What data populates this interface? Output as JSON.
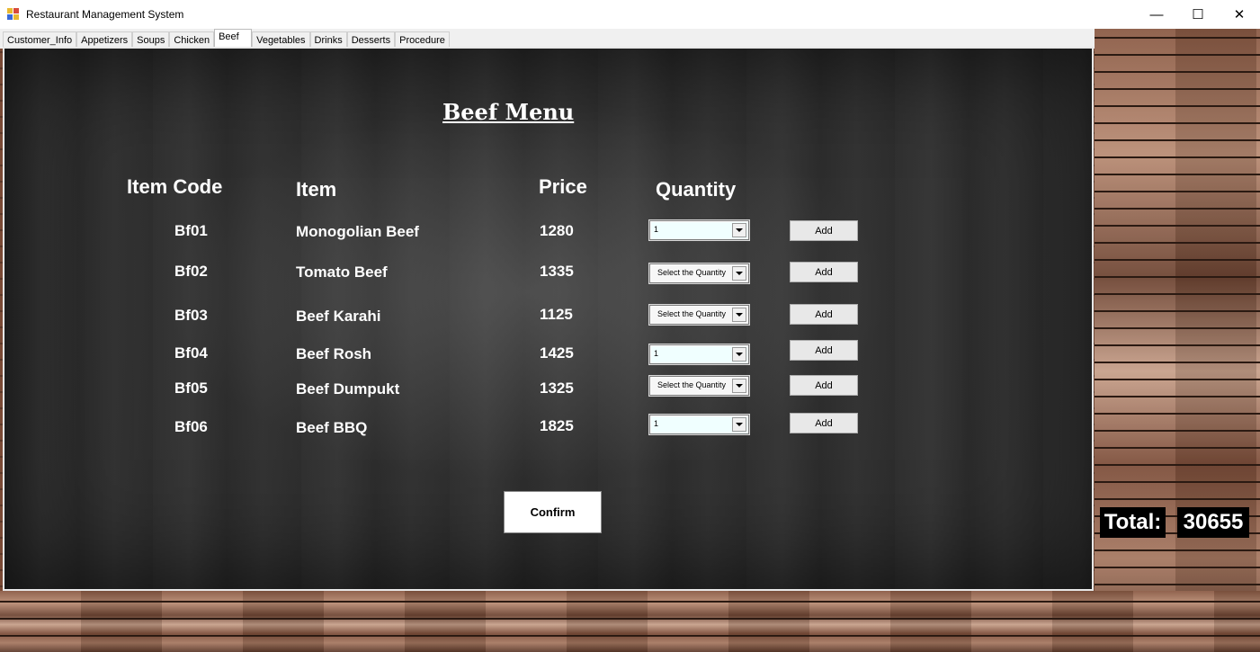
{
  "window": {
    "title": "Restaurant Management System",
    "controls": {
      "minimize": "—",
      "maximize": "☐",
      "close": "✕"
    }
  },
  "tabs": [
    {
      "label": "Customer_Info",
      "active": false
    },
    {
      "label": "Appetizers",
      "active": false
    },
    {
      "label": "Soups",
      "active": false
    },
    {
      "label": "Chicken",
      "active": false
    },
    {
      "label": "Beef",
      "active": true
    },
    {
      "label": "Vegetables",
      "active": false
    },
    {
      "label": "Drinks",
      "active": false
    },
    {
      "label": "Desserts",
      "active": false
    },
    {
      "label": "Procedure",
      "active": false
    }
  ],
  "menu": {
    "heading": "Beef Menu",
    "columns": {
      "code": "Item Code",
      "item": "Item",
      "price": "Price",
      "quantity": "Quantity"
    },
    "rows": [
      {
        "code": "Bf01",
        "item": "Monogolian Beef",
        "price": "1280",
        "quantity": "1",
        "add": "Add"
      },
      {
        "code": "Bf02",
        "item": "Tomato Beef",
        "price": "1335",
        "quantity": "Select the Quantity",
        "add": "Add"
      },
      {
        "code": "Bf03",
        "item": "Beef Karahi",
        "price": "1125",
        "quantity": "Select the Quantity",
        "add": "Add"
      },
      {
        "code": "Bf04",
        "item": "Beef Rosh",
        "price": "1425",
        "quantity": "1",
        "add": "Add"
      },
      {
        "code": "Bf05",
        "item": "Beef Dumpukt",
        "price": "1325",
        "quantity": "Select the Quantity",
        "add": "Add"
      },
      {
        "code": "Bf06",
        "item": "Beef BBQ",
        "price": "1825",
        "quantity": "1",
        "add": "Add"
      }
    ],
    "confirm_label": "Confirm"
  },
  "total": {
    "label": "Total:",
    "value": "30655"
  }
}
